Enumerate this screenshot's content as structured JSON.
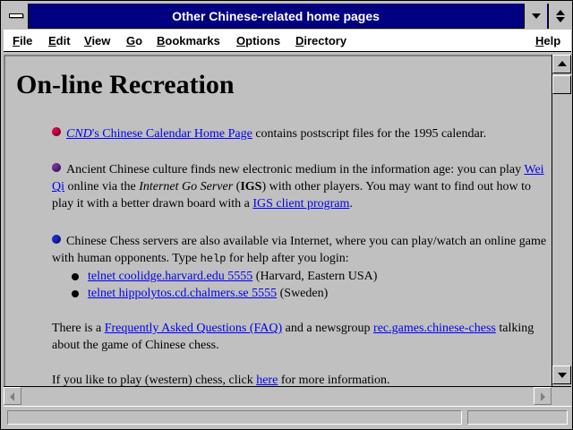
{
  "window": {
    "title": "Other Chinese-related home pages"
  },
  "menu": {
    "file": "File",
    "edit": "Edit",
    "view": "View",
    "go": "Go",
    "bookmarks": "Bookmarks",
    "options": "Options",
    "directory": "Directory",
    "help": "Help"
  },
  "page": {
    "heading": "On-line Recreation",
    "item1": {
      "link_em": "CND",
      "link_rest": "'s Chinese Calendar Home Page",
      "text": " contains postscript files for the 1995 calendar."
    },
    "item2": {
      "text1": "Ancient Chinese culture finds new electronic medium in the information age: you can play ",
      "link_weiqi": "Wei Qi",
      "text2": " online via the ",
      "em_server": "Internet Go Server",
      "text3": " (",
      "strong_igs": "IGS",
      "text4": ") with other players. You may want to find out how to play it with a better drawn board with a ",
      "link_client": "IGS client program",
      "text5": "."
    },
    "item3": {
      "text1": "Chinese Chess servers are also available via Internet, where you can play/watch an online game with human opponents. Type ",
      "code": "help",
      "text2": " for help after you login:"
    },
    "telnet": [
      {
        "link": "telnet coolidge.harvard.edu 5555",
        "note": " (Harvard, Eastern USA)"
      },
      {
        "link": "telnet hippolytos.cd.chalmers.se 5555",
        "note": " (Sweden)"
      }
    ],
    "faq": {
      "text1": "There is a ",
      "link_faq": "Frequently Asked Questions (FAQ)",
      "text2": " and a newsgroup ",
      "link_news": "rec.games.chinese-chess",
      "text3": " talking about the game of Chinese chess."
    },
    "western": {
      "text1": "If you like to play (western) chess, click ",
      "link_here": "here",
      "text2": " for more information."
    }
  },
  "icons": {
    "system_menu": "system-menu-icon",
    "minimize": "minimize-icon",
    "maximize": "restore-icon",
    "scroll_up": "arrow-up-icon",
    "scroll_down": "arrow-down-icon",
    "scroll_left": "arrow-left-icon",
    "scroll_right": "arrow-right-icon"
  },
  "colors": {
    "titlebar": "#000080",
    "link": "#0000ee",
    "bullet_red": "#e0004a",
    "bullet_purple": "#7030a0",
    "bullet_blue": "#1a2bd0"
  }
}
